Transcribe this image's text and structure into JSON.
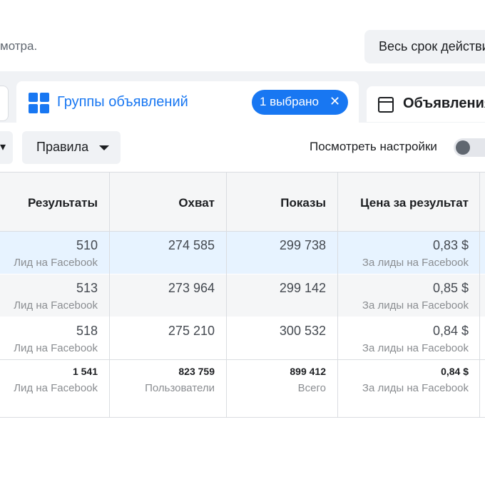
{
  "header": {
    "partial_text": "мотра.",
    "date_range_label": "Весь срок действия"
  },
  "tabs": {
    "active_label": "Группы объявлений",
    "selected_chip": "1 выбрано",
    "next_label": "Объявления"
  },
  "toolbar": {
    "rules_label": "Правила",
    "view_settings_label": "Посмотреть настройки",
    "view_settings_on": false
  },
  "table": {
    "columns": [
      "Результаты",
      "Охват",
      "Показы",
      "Цена за результат"
    ],
    "rows": [
      {
        "results": "510",
        "results_sub": "Лид на Facebook",
        "reach": "274 585",
        "impressions": "299 738",
        "cpr": "0,83 $",
        "cpr_sub": "За лиды на Facebook",
        "highlighted": true
      },
      {
        "results": "513",
        "results_sub": "Лид на Facebook",
        "reach": "273 964",
        "impressions": "299 142",
        "cpr": "0,85 $",
        "cpr_sub": "За лиды на Facebook",
        "highlighted": false
      },
      {
        "results": "518",
        "results_sub": "Лид на Facebook",
        "reach": "275 210",
        "impressions": "300 532",
        "cpr": "0,84 $",
        "cpr_sub": "За лиды на Facebook",
        "highlighted": false
      }
    ],
    "totals": {
      "results": "1 541",
      "results_sub": "Лид на Facebook",
      "reach": "823 759",
      "reach_sub": "Пользователи",
      "impressions": "899 412",
      "impressions_sub": "Всего",
      "cpr": "0,84 $",
      "cpr_sub": "За лиды на Facebook"
    }
  },
  "colors": {
    "accent": "#1877f2",
    "highlight_row": "#e7f3ff",
    "alt_row": "#f5f6f7"
  }
}
